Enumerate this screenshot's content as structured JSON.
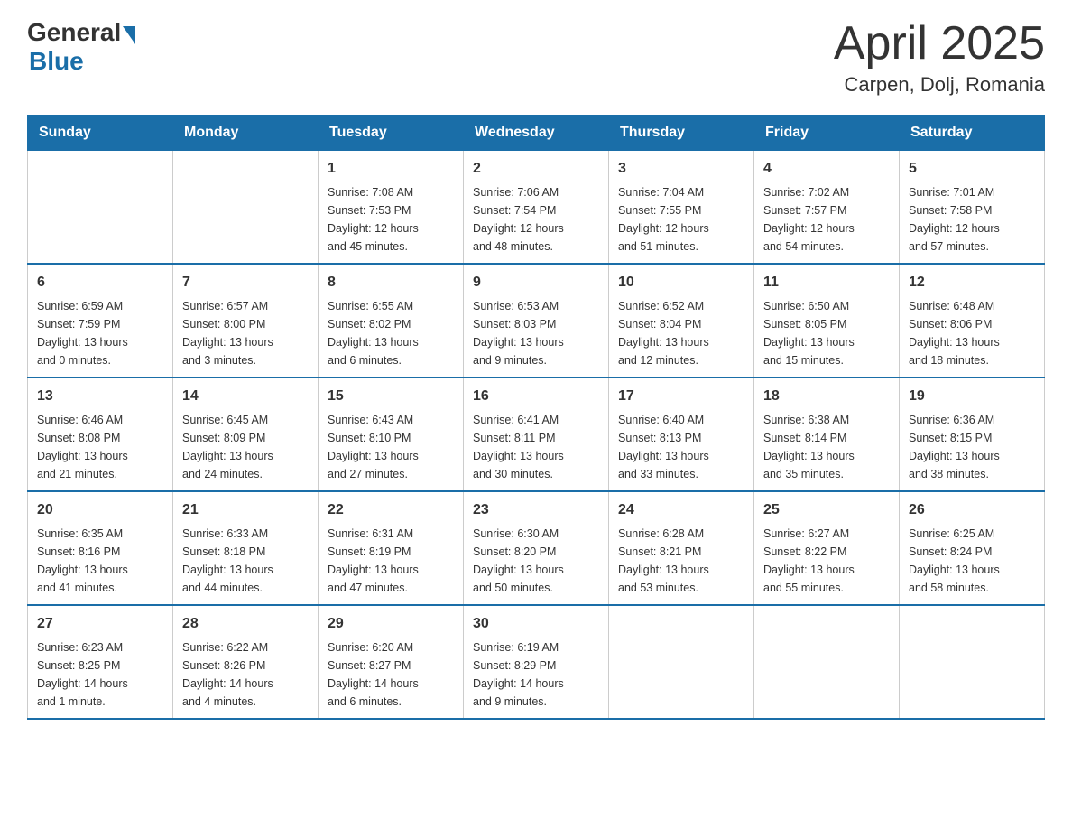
{
  "header": {
    "logo_general": "General",
    "logo_blue": "Blue",
    "title": "April 2025",
    "subtitle": "Carpen, Dolj, Romania"
  },
  "days_of_week": [
    "Sunday",
    "Monday",
    "Tuesday",
    "Wednesday",
    "Thursday",
    "Friday",
    "Saturday"
  ],
  "weeks": [
    [
      {
        "day": "",
        "info": ""
      },
      {
        "day": "",
        "info": ""
      },
      {
        "day": "1",
        "info": "Sunrise: 7:08 AM\nSunset: 7:53 PM\nDaylight: 12 hours\nand 45 minutes."
      },
      {
        "day": "2",
        "info": "Sunrise: 7:06 AM\nSunset: 7:54 PM\nDaylight: 12 hours\nand 48 minutes."
      },
      {
        "day": "3",
        "info": "Sunrise: 7:04 AM\nSunset: 7:55 PM\nDaylight: 12 hours\nand 51 minutes."
      },
      {
        "day": "4",
        "info": "Sunrise: 7:02 AM\nSunset: 7:57 PM\nDaylight: 12 hours\nand 54 minutes."
      },
      {
        "day": "5",
        "info": "Sunrise: 7:01 AM\nSunset: 7:58 PM\nDaylight: 12 hours\nand 57 minutes."
      }
    ],
    [
      {
        "day": "6",
        "info": "Sunrise: 6:59 AM\nSunset: 7:59 PM\nDaylight: 13 hours\nand 0 minutes."
      },
      {
        "day": "7",
        "info": "Sunrise: 6:57 AM\nSunset: 8:00 PM\nDaylight: 13 hours\nand 3 minutes."
      },
      {
        "day": "8",
        "info": "Sunrise: 6:55 AM\nSunset: 8:02 PM\nDaylight: 13 hours\nand 6 minutes."
      },
      {
        "day": "9",
        "info": "Sunrise: 6:53 AM\nSunset: 8:03 PM\nDaylight: 13 hours\nand 9 minutes."
      },
      {
        "day": "10",
        "info": "Sunrise: 6:52 AM\nSunset: 8:04 PM\nDaylight: 13 hours\nand 12 minutes."
      },
      {
        "day": "11",
        "info": "Sunrise: 6:50 AM\nSunset: 8:05 PM\nDaylight: 13 hours\nand 15 minutes."
      },
      {
        "day": "12",
        "info": "Sunrise: 6:48 AM\nSunset: 8:06 PM\nDaylight: 13 hours\nand 18 minutes."
      }
    ],
    [
      {
        "day": "13",
        "info": "Sunrise: 6:46 AM\nSunset: 8:08 PM\nDaylight: 13 hours\nand 21 minutes."
      },
      {
        "day": "14",
        "info": "Sunrise: 6:45 AM\nSunset: 8:09 PM\nDaylight: 13 hours\nand 24 minutes."
      },
      {
        "day": "15",
        "info": "Sunrise: 6:43 AM\nSunset: 8:10 PM\nDaylight: 13 hours\nand 27 minutes."
      },
      {
        "day": "16",
        "info": "Sunrise: 6:41 AM\nSunset: 8:11 PM\nDaylight: 13 hours\nand 30 minutes."
      },
      {
        "day": "17",
        "info": "Sunrise: 6:40 AM\nSunset: 8:13 PM\nDaylight: 13 hours\nand 33 minutes."
      },
      {
        "day": "18",
        "info": "Sunrise: 6:38 AM\nSunset: 8:14 PM\nDaylight: 13 hours\nand 35 minutes."
      },
      {
        "day": "19",
        "info": "Sunrise: 6:36 AM\nSunset: 8:15 PM\nDaylight: 13 hours\nand 38 minutes."
      }
    ],
    [
      {
        "day": "20",
        "info": "Sunrise: 6:35 AM\nSunset: 8:16 PM\nDaylight: 13 hours\nand 41 minutes."
      },
      {
        "day": "21",
        "info": "Sunrise: 6:33 AM\nSunset: 8:18 PM\nDaylight: 13 hours\nand 44 minutes."
      },
      {
        "day": "22",
        "info": "Sunrise: 6:31 AM\nSunset: 8:19 PM\nDaylight: 13 hours\nand 47 minutes."
      },
      {
        "day": "23",
        "info": "Sunrise: 6:30 AM\nSunset: 8:20 PM\nDaylight: 13 hours\nand 50 minutes."
      },
      {
        "day": "24",
        "info": "Sunrise: 6:28 AM\nSunset: 8:21 PM\nDaylight: 13 hours\nand 53 minutes."
      },
      {
        "day": "25",
        "info": "Sunrise: 6:27 AM\nSunset: 8:22 PM\nDaylight: 13 hours\nand 55 minutes."
      },
      {
        "day": "26",
        "info": "Sunrise: 6:25 AM\nSunset: 8:24 PM\nDaylight: 13 hours\nand 58 minutes."
      }
    ],
    [
      {
        "day": "27",
        "info": "Sunrise: 6:23 AM\nSunset: 8:25 PM\nDaylight: 14 hours\nand 1 minute."
      },
      {
        "day": "28",
        "info": "Sunrise: 6:22 AM\nSunset: 8:26 PM\nDaylight: 14 hours\nand 4 minutes."
      },
      {
        "day": "29",
        "info": "Sunrise: 6:20 AM\nSunset: 8:27 PM\nDaylight: 14 hours\nand 6 minutes."
      },
      {
        "day": "30",
        "info": "Sunrise: 6:19 AM\nSunset: 8:29 PM\nDaylight: 14 hours\nand 9 minutes."
      },
      {
        "day": "",
        "info": ""
      },
      {
        "day": "",
        "info": ""
      },
      {
        "day": "",
        "info": ""
      }
    ]
  ]
}
